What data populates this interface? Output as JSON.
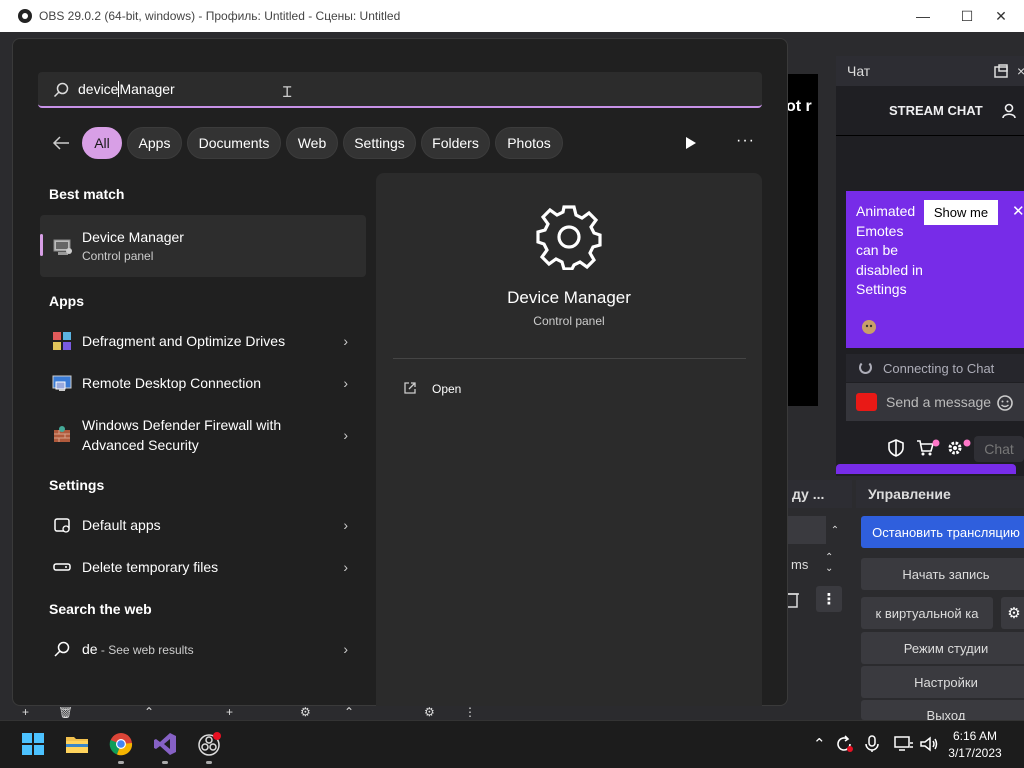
{
  "obs": {
    "title": "OBS 29.0.2 (64-bit, windows) - Профиль: Untitled - Сцены: Untitled",
    "min_glyph": "—",
    "max_glyph": "☐",
    "close_glyph": "✕",
    "preview_text": "ot r",
    "chat_dock": {
      "title": "Чат",
      "stream_chat": "STREAM CHAT",
      "banner_text": "Animated Emotes can be disabled in Settings",
      "show_me": "Show me",
      "connecting": "Connecting to Chat",
      "send_placeholder": "Send a message",
      "chat_button": "Chat"
    },
    "mid_dock": {
      "title": "ду ...",
      "ms_label": "ms"
    },
    "controls": {
      "title": "Управление",
      "buttons": [
        "Остановить трансляцию",
        "Начать запись",
        "к виртуальной ка",
        "Режим студии",
        "Настройки",
        "Выход"
      ]
    }
  },
  "search": {
    "query_typed": "device",
    "query_suggest": " Manager",
    "filters": [
      "All",
      "Apps",
      "Documents",
      "Web",
      "Settings",
      "Folders",
      "Photos"
    ],
    "best_match_title": "Best match",
    "best_match": {
      "name": "Device Manager",
      "sub": "Control panel"
    },
    "apps_title": "Apps",
    "apps": [
      {
        "label": "Defragment and Optimize Drives",
        "icon": "defrag-icon"
      },
      {
        "label": "Remote Desktop Connection",
        "icon": "remote-desktop-icon"
      },
      {
        "label": "Windows Defender Firewall with Advanced Security",
        "icon": "firewall-icon"
      }
    ],
    "settings_title": "Settings",
    "settings": [
      {
        "label": "Default apps",
        "icon": "default-apps-icon"
      },
      {
        "label": "Delete temporary files",
        "icon": "storage-icon"
      }
    ],
    "web_title": "Search the web",
    "web": {
      "query": "de",
      "suffix": " - See web results"
    },
    "detail": {
      "name": "Device Manager",
      "sub": "Control panel",
      "action_open": "Open"
    }
  },
  "taskbar": {
    "time": "6:16 AM",
    "date": "3/17/2023",
    "apps": [
      "windows-start-icon",
      "file-explorer-icon",
      "chrome-icon",
      "visual-studio-icon",
      "obs-icon"
    ]
  },
  "colors": {
    "accent_purple": "#d89fe6",
    "twitch_purple": "#772ce8",
    "obs_blue": "#2f5fdd"
  }
}
